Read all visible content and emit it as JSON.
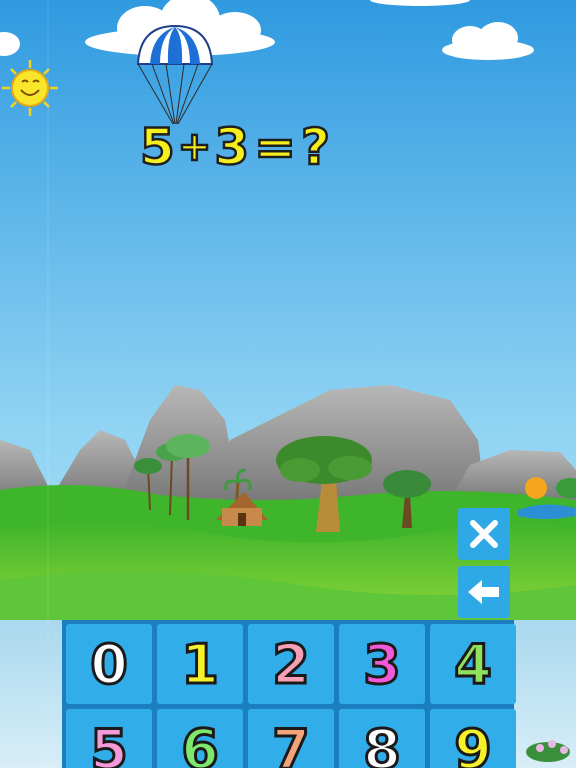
{
  "equation": {
    "operand_a": "5",
    "operator": "+",
    "operand_b": "3",
    "equals": "=",
    "unknown": "?"
  },
  "controls": {
    "clear_icon": "close-icon",
    "backspace_icon": "backspace-arrow-icon"
  },
  "keypad": {
    "keys": [
      {
        "label": "0",
        "color": "#ffffff"
      },
      {
        "label": "1",
        "color": "#f7f12a"
      },
      {
        "label": "2",
        "color": "#f5a0b4"
      },
      {
        "label": "3",
        "color": "#f259d6"
      },
      {
        "label": "4",
        "color": "#8fe05a"
      },
      {
        "label": "5",
        "color": "#f59ad8"
      },
      {
        "label": "6",
        "color": "#7de86c"
      },
      {
        "label": "7",
        "color": "#f3a47a"
      },
      {
        "label": "8",
        "color": "#ffffff"
      },
      {
        "label": "9",
        "color": "#f7f12a"
      }
    ]
  },
  "colors": {
    "sky_top": "#2f9ae0",
    "sky_bottom": "#c6eafa",
    "grass": "#4fc23a",
    "keypad_key": "#31ade9",
    "equation_text": "#f5ef1e"
  }
}
